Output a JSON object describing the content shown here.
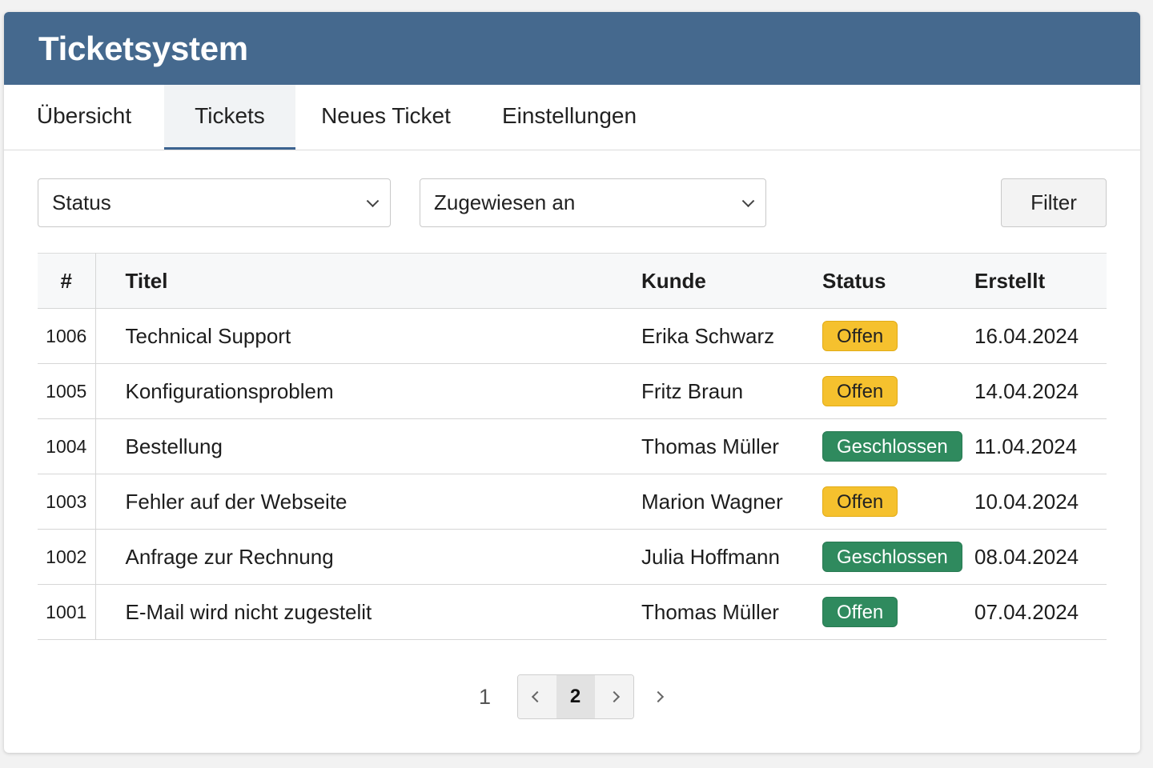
{
  "header": {
    "title": "Ticketsystem",
    "bg": "#45698e"
  },
  "tabs": [
    {
      "label": "Übersicht",
      "active": false
    },
    {
      "label": "Tickets",
      "active": true
    },
    {
      "label": "Neues Ticket",
      "active": false
    },
    {
      "label": "Einstellungen",
      "active": false
    }
  ],
  "filters": {
    "status_select": "Status",
    "assigned_select": "Zugewiesen an",
    "filter_button": "Filter"
  },
  "table": {
    "columns": [
      "#",
      "Titel",
      "Kunde",
      "Status",
      "Erstellt"
    ],
    "rows": [
      {
        "id": "1006",
        "title": "Technical Support",
        "customer": "Erika Schwarz",
        "status": "Offen",
        "status_type": "open",
        "created": "16.04.2024"
      },
      {
        "id": "1005",
        "title": "Konfigurationsproblem",
        "customer": "Fritz Braun",
        "status": "Offen",
        "status_type": "open",
        "created": "14.04.2024"
      },
      {
        "id": "1004",
        "title": "Bestellung",
        "customer": "Thomas Müller",
        "status": "Geschlossen",
        "status_type": "closed",
        "created": "11.04.2024"
      },
      {
        "id": "1003",
        "title": "Fehler auf der Webseite",
        "customer": "Marion Wagner",
        "status": "Offen",
        "status_type": "open",
        "created": "10.04.2024"
      },
      {
        "id": "1002",
        "title": "Anfrage zur Rechnung",
        "customer": "Julia Hoffmann",
        "status": "Geschlossen",
        "status_type": "closed",
        "created": "08.04.2024"
      },
      {
        "id": "1001",
        "title": "E-Mail wird nicht zugestelit",
        "customer": "Thomas Müller",
        "status": "Offen",
        "status_type": "closed",
        "created": "07.04.2024"
      }
    ]
  },
  "pagination": {
    "first_page": "1",
    "current_page": "2"
  },
  "colors": {
    "open": "#f5c12e",
    "closed": "#2f8a5e",
    "tab_active_border": "#3c6390"
  }
}
